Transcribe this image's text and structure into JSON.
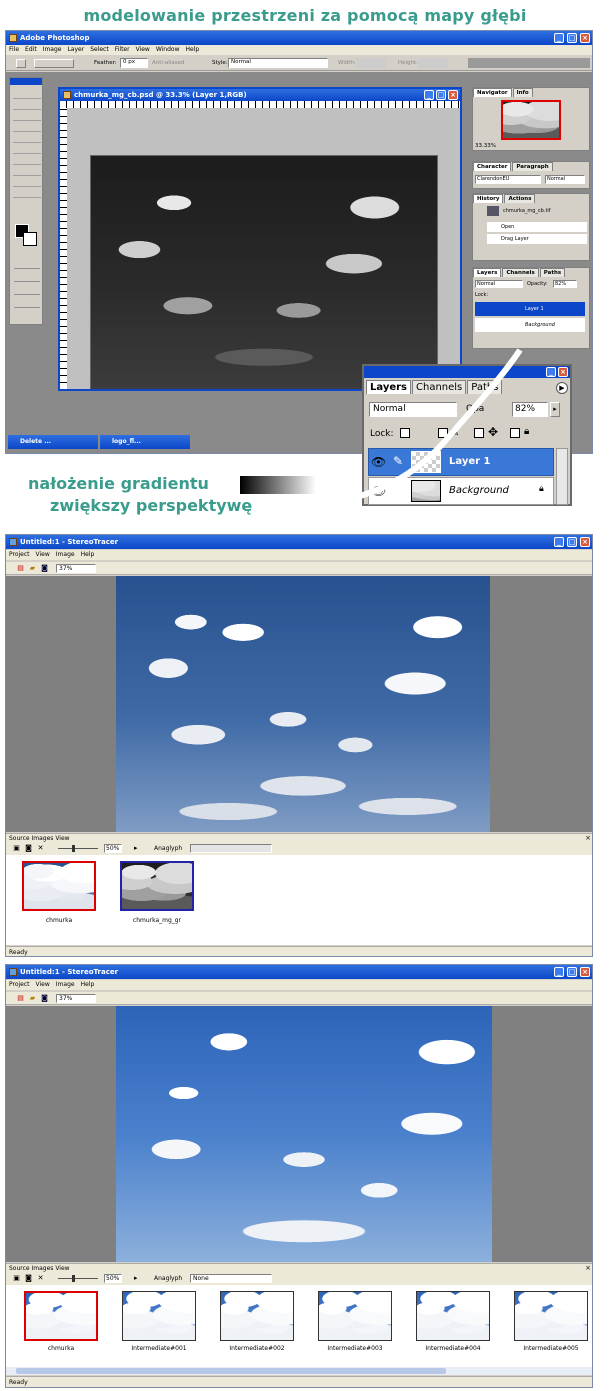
{
  "heading": "modelowanie przestrzeni za pomocą mapy głębi",
  "photoshop": {
    "title": "Adobe Photoshop",
    "menu": [
      "File",
      "Edit",
      "Image",
      "Layer",
      "Select",
      "Filter",
      "View",
      "Window",
      "Help"
    ],
    "options": {
      "feather_label": "Feather:",
      "feather_value": "0 px",
      "antialiased": "Anti-aliased",
      "style_label": "Style:",
      "style_value": "Normal",
      "width_label": "Width:",
      "height_label": "Height:"
    },
    "doc_title": "chmurka_mg_cb.psd @ 33.3% (Layer 1,RGB)",
    "navigator": {
      "tabs": [
        "Navigator",
        "Info"
      ],
      "zoom": "33.33%"
    },
    "character": {
      "tabs": [
        "Character",
        "Paragraph"
      ],
      "font": "ClarendonEU",
      "style": "Normal"
    },
    "history": {
      "tabs": [
        "History",
        "Actions"
      ],
      "snapshot": "chmurka_mg_cb.tif",
      "items": [
        "Open",
        "Drag Layer"
      ]
    },
    "layers_small": {
      "tabs": [
        "Layers",
        "Channels",
        "Paths"
      ],
      "blend": "Normal",
      "opacity_label": "Opacity:",
      "opacity": "82%",
      "lock": "Lock:",
      "layers": [
        "Layer 1",
        "Background"
      ]
    },
    "layers_zoom": {
      "tabs": [
        "Layers",
        "Channels",
        "Paths"
      ],
      "blend": "Normal",
      "opacity_label": "Opa",
      "opacity": "82%",
      "lock": "Lock:",
      "layers": [
        "Layer 1",
        "Background"
      ]
    },
    "taskbar": [
      "Delete ...",
      "logo_fl..."
    ]
  },
  "annotation": {
    "line1": "nałożenie gradientu",
    "line2": "zwiększy perspektywę"
  },
  "st1": {
    "title": "Untitled:1 - StereoTracer",
    "menu": [
      "Project",
      "View",
      "Image",
      "Help"
    ],
    "zoom": "37%",
    "source_view": "Source Images View",
    "source_zoom": "50%",
    "mode": "Anaglyph",
    "mode2": "",
    "thumbs": [
      "chmurka",
      "chmurka_mg_gr"
    ],
    "status": "Ready"
  },
  "st2": {
    "title": "Untitled:1 - StereoTracer",
    "menu": [
      "Project",
      "View",
      "Image",
      "Help"
    ],
    "zoom": "37%",
    "source_view": "Source Images View",
    "source_zoom": "50%",
    "mode": "Anaglyph",
    "mode2": "None",
    "thumbs": [
      "chmurka",
      "Intermediate#001",
      "Intermediate#002",
      "Intermediate#003",
      "Intermediate#004",
      "Intermediate#005"
    ],
    "status": "Ready"
  },
  "icons": [
    "photoshop-icon",
    "stereotracer-icon",
    "eye-icon",
    "brush-icon",
    "lock-icon",
    "move-icon",
    "new-icon",
    "open-icon",
    "save-icon",
    "close-icon",
    "play-icon",
    "minimize-icon",
    "maximize-icon",
    "curved-arrow-icon"
  ]
}
